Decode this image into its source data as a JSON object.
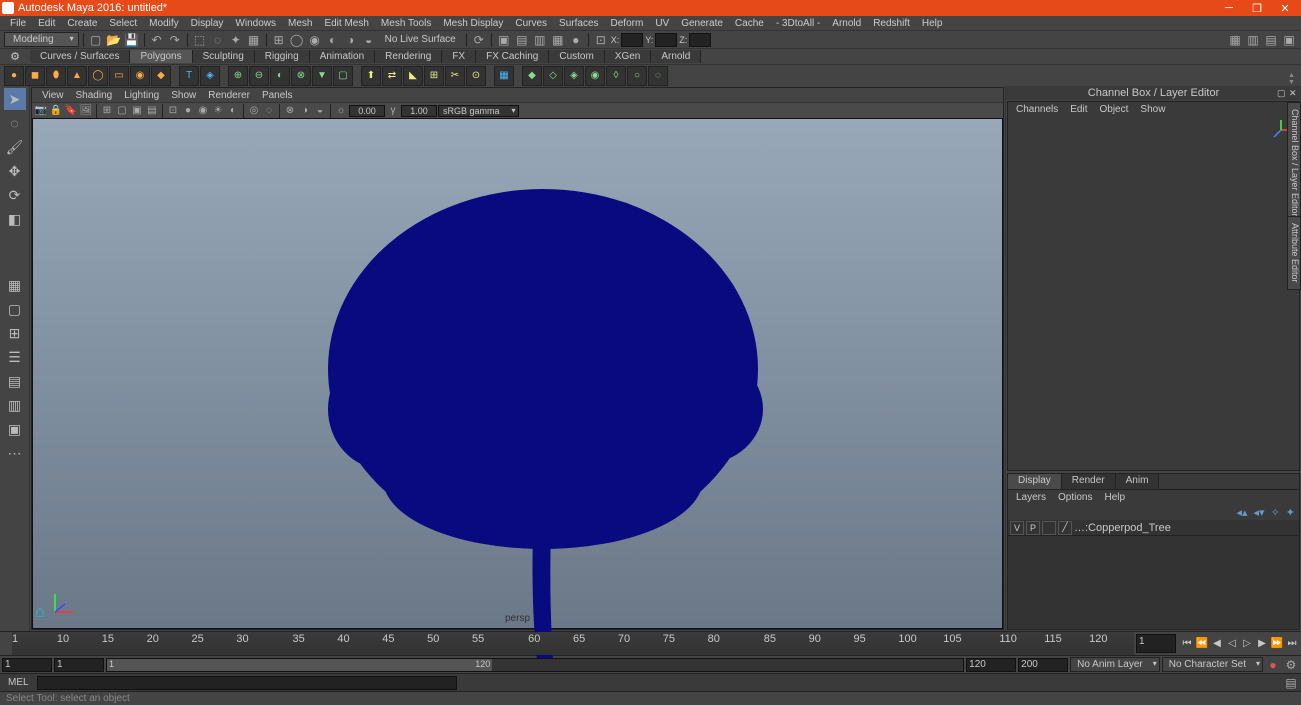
{
  "title": "Autodesk Maya 2016: untitled*",
  "menus": [
    "File",
    "Edit",
    "Create",
    "Select",
    "Modify",
    "Display",
    "Windows",
    "Mesh",
    "Edit Mesh",
    "Mesh Tools",
    "Mesh Display",
    "Curves",
    "Surfaces",
    "Deform",
    "UV",
    "Generate",
    "Cache",
    "- 3DtoAll -",
    "Arnold",
    "Redshift",
    "Help"
  ],
  "workspace": "Modeling",
  "noLive": "No Live Surface",
  "coord": {
    "x": "X:",
    "y": "Y:",
    "z": "Z:"
  },
  "shelves": [
    "Curves / Surfaces",
    "Polygons",
    "Sculpting",
    "Rigging",
    "Animation",
    "Rendering",
    "FX",
    "FX Caching",
    "Custom",
    "XGen",
    "Arnold"
  ],
  "viewMenus": [
    "View",
    "Shading",
    "Lighting",
    "Show",
    "Renderer",
    "Panels"
  ],
  "vtNums": {
    "a": "0.00",
    "b": "1.00"
  },
  "colorSpace": "sRGB gamma",
  "persp": "persp",
  "rpTitle": "Channel Box / Layer Editor",
  "chMenus": [
    "Channels",
    "Edit",
    "Object",
    "Show"
  ],
  "lpTabs": [
    "Display",
    "Render",
    "Anim"
  ],
  "lpMenus": [
    "Layers",
    "Options",
    "Help"
  ],
  "layer": {
    "v": "V",
    "p": "P",
    "name": "…:Copperpod_Tree"
  },
  "sideTabs": [
    "Channel Box / Layer Editor",
    "Attribute Editor"
  ],
  "timeline": {
    "ticks": [
      "1",
      "15",
      "30",
      "45",
      "60",
      "75",
      "90",
      "105",
      "120"
    ],
    "tickVals": [
      "1",
      "10",
      "15",
      "20",
      "25",
      "30",
      "35",
      "40",
      "45",
      "50",
      "55",
      "60",
      "65",
      "70",
      "75",
      "80",
      "85",
      "90",
      "95",
      "100",
      "105",
      "110",
      "115",
      "120"
    ],
    "frame": "1"
  },
  "range": {
    "start": "1",
    "in": "1",
    "sliderIn": "1",
    "sliderOut": "120",
    "out": "120",
    "end": "200",
    "animLayer": "No Anim Layer",
    "charSet": "No Character Set"
  },
  "cmd": "MEL",
  "help": "Select Tool: select an object"
}
